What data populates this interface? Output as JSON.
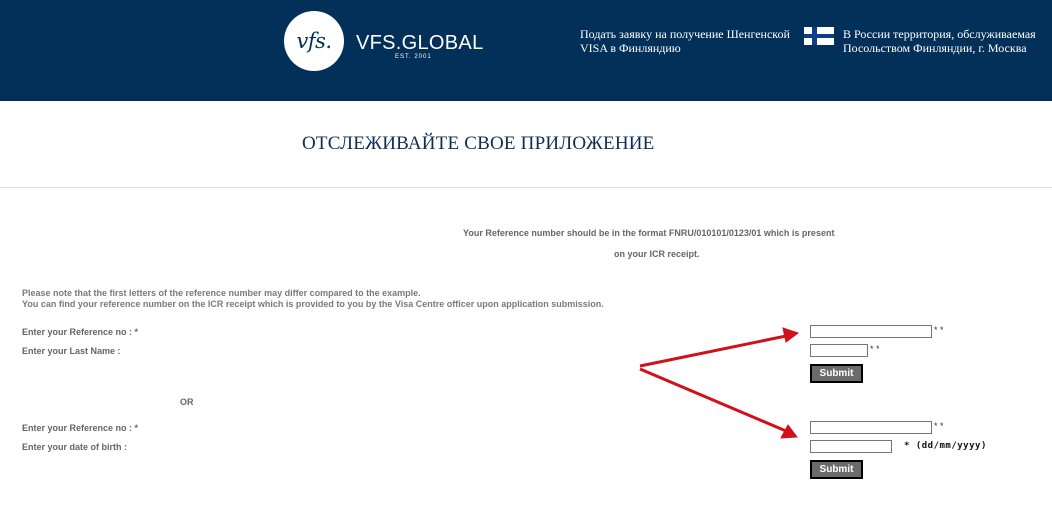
{
  "header": {
    "logo_mark": "vfs.",
    "logo_name": "VFS.GLOBAL",
    "logo_est": "EST. 2001",
    "left_text": "Подать заявку на получение Шенгенской VISA в Финляндию",
    "right_text": "В России территория, обслуживаемая Посольством Финляндии, г. Москва",
    "colors": {
      "background": "#033059",
      "text": "#ffffff"
    },
    "flag_icon": "finland-flag-icon"
  },
  "main": {
    "title": "ОТСЛЕЖИВАЙТЕ СВОЕ ПРИЛОЖЕНИЕ",
    "format_note_line1": "Your Reference number should be in the format FNRU/010101/0123/01 which is present",
    "format_note_line2": "on your ICR receipt.",
    "info_line1": "Please note that the first letters of the reference number may differ compared to the example.",
    "info_line2": "You can find your reference number on the ICR receipt which is provided to you by the Visa Centre officer upon application submission."
  },
  "form1": {
    "ref_label": "Enter your Reference no : *",
    "ref_value": "",
    "ref_req": "* *",
    "lastname_label": "Enter your Last Name :",
    "lastname_value": "",
    "lastname_req": "* *",
    "submit_label": "Submit"
  },
  "or_label": "OR",
  "form2": {
    "ref_label": "Enter your Reference no : *",
    "ref_value": "",
    "ref_req": "* *",
    "dob_label": "Enter your date of birth :",
    "dob_value": "",
    "dob_hint": "* (dd/mm/yyyy)",
    "submit_label": "Submit"
  },
  "annotation_color": "#d0101a"
}
